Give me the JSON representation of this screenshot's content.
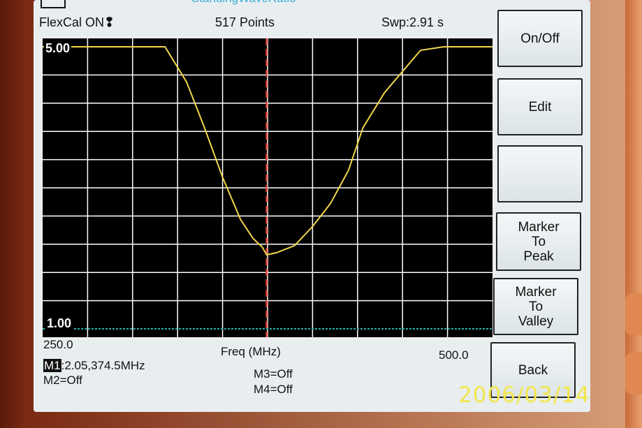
{
  "header": {
    "title": "StandingWaveRatio",
    "flexcal": "FlexCal ON",
    "flexcal_icon": "exclamation-icon",
    "points": "517 Points",
    "sweep": "Swp:2.91 s"
  },
  "plot": {
    "y_top_label": "5.00",
    "y_bottom_label": "1.00",
    "x_start_label": "250.0",
    "x_axis_label": "Freq (MHz)",
    "x_end_label": "500.0",
    "trace_color": "#f2d54a",
    "marker_color": "#e8463a",
    "baseline_color": "#2ab0a8",
    "grid_color": "#ffffff",
    "chart_data": {
      "type": "line",
      "xlim": [
        250.0,
        500.0
      ],
      "ylim": [
        1.0,
        5.0
      ],
      "xlabel": "Freq (MHz)",
      "ylabel": "",
      "series": [
        {
          "x": [
            250,
            273,
            300,
            318,
            330,
            340,
            350,
            360,
            367,
            372,
            374.5,
            380,
            390,
            400,
            410,
            420,
            428,
            440,
            450,
            460,
            473,
            500
          ],
          "values": [
            5.0,
            5.0,
            5.0,
            5.0,
            4.5,
            3.85,
            3.15,
            2.55,
            2.28,
            2.16,
            2.05,
            2.08,
            2.18,
            2.45,
            2.78,
            3.25,
            3.85,
            4.35,
            4.65,
            4.95,
            5.0,
            5.0
          ]
        }
      ],
      "marker": {
        "x": 374.5,
        "y": 2.05
      }
    }
  },
  "markers": {
    "m1_tag": "M1",
    "m1_value": ":2.05,374.5MHz",
    "m2": "M2=Off",
    "m3": "M3=Off",
    "m4": "M4=Off"
  },
  "softkeys": [
    {
      "label": "On/Off"
    },
    {
      "label": "Edit"
    },
    {
      "label": ""
    },
    {
      "label": "Marker\nTo\nPeak"
    },
    {
      "label": "Marker\nTo\nValley"
    },
    {
      "label": "Back"
    }
  ],
  "photo_date": "2006/03/14"
}
